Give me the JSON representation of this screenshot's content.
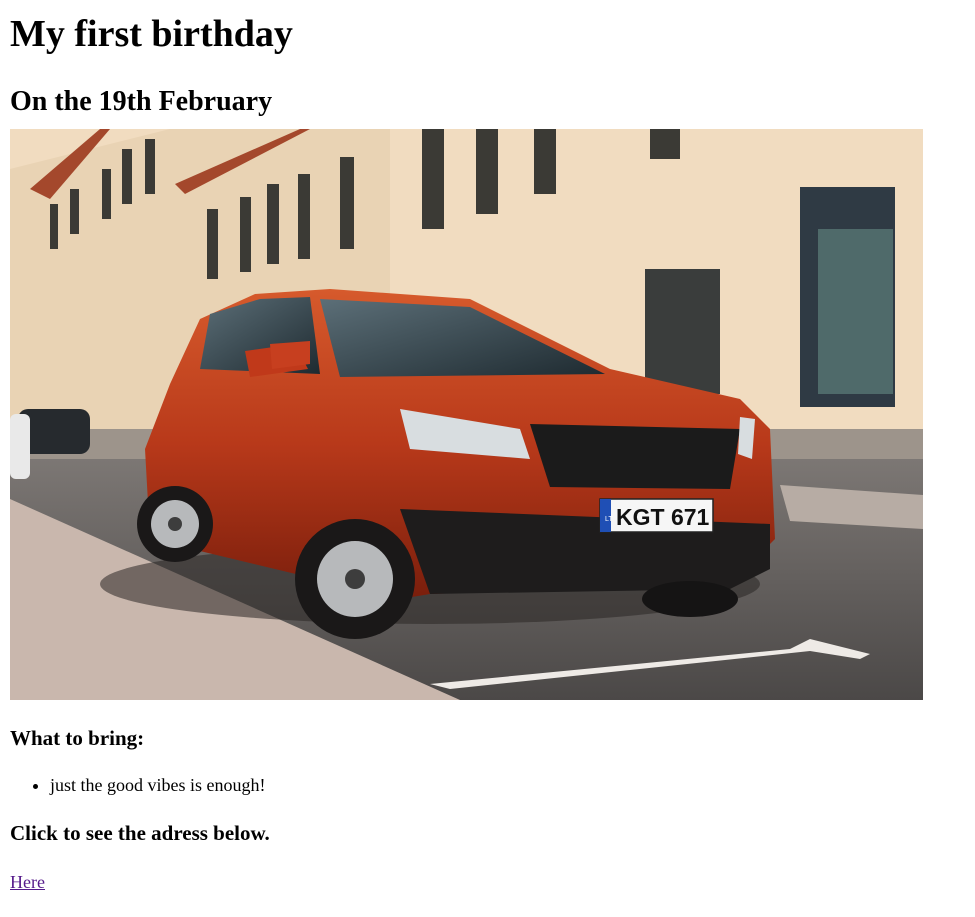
{
  "page": {
    "title": "My first birthday",
    "subtitle": "On the 19th February",
    "image": {
      "subject": "red SUV parked on street",
      "plate_text": "KGT 671",
      "plate_country": "LT",
      "colors": {
        "car": "#b8391a",
        "building": "#f1dcc0",
        "road": "#5d5a59",
        "sidewalk": "#c9b7ad",
        "sky": "#dce6ec"
      }
    },
    "bring_heading": "What to bring:",
    "bring_items": [
      "just the good vibes is enough!"
    ],
    "click_heading": "Click to see the adress below.",
    "link_text": "Here",
    "link_color": "#551a8b"
  }
}
